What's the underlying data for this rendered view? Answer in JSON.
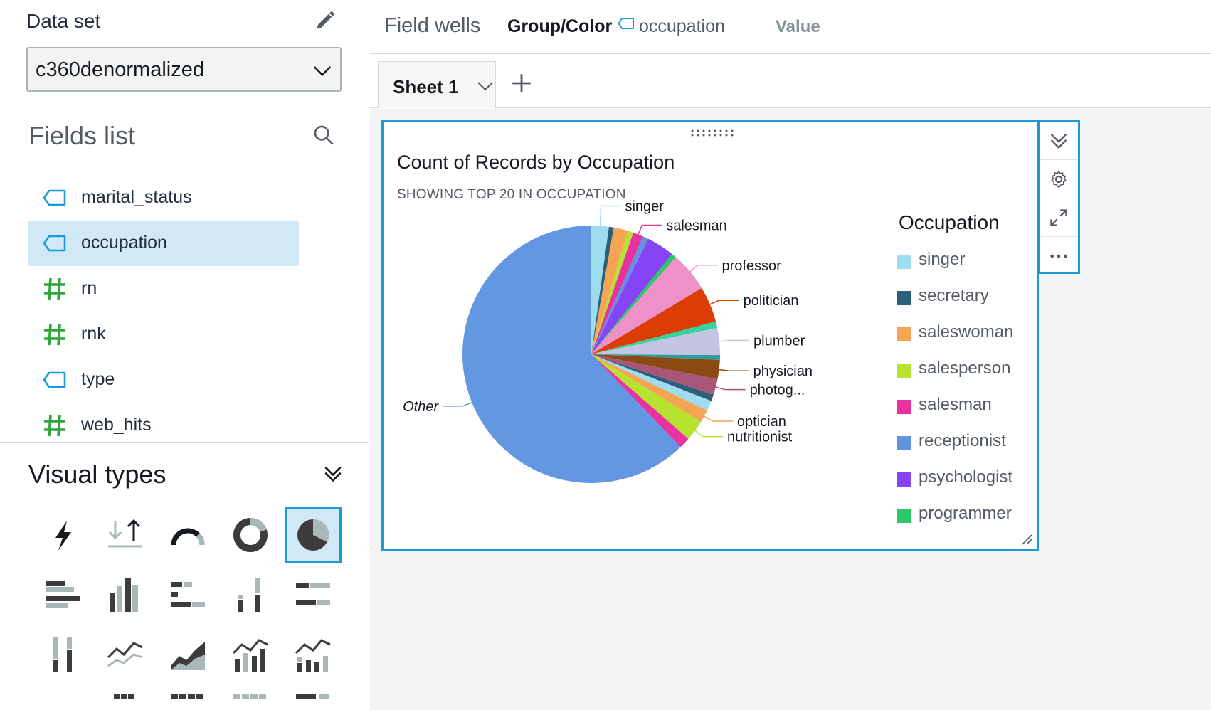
{
  "dataset": {
    "title": "Data set",
    "selected": "c360denormalized"
  },
  "fields_list": {
    "title": "Fields list",
    "items": [
      {
        "label": "marital_status",
        "kind": "dimension"
      },
      {
        "label": "occupation",
        "kind": "dimension",
        "selected": true
      },
      {
        "label": "rn",
        "kind": "measure"
      },
      {
        "label": "rnk",
        "kind": "measure"
      },
      {
        "label": "type",
        "kind": "dimension"
      },
      {
        "label": "web_hits",
        "kind": "measure"
      }
    ]
  },
  "visual_types": {
    "title": "Visual types"
  },
  "field_wells": {
    "title": "Field wells",
    "group_color_label": "Group/Color",
    "group_color_value": "occupation",
    "value_label": "Value"
  },
  "sheet": {
    "tab_label": "Sheet 1"
  },
  "visual": {
    "title": "Count of Records by Occupation",
    "subtitle": "SHOWING TOP 20 IN OCCUPATION",
    "legend_title": "Occupation"
  },
  "colors": {
    "accent": "#1a9bd7",
    "selected_bg": "#d1e9f6",
    "dimension_icon": "#1a9bd7",
    "measure_icon": "#2ea53a"
  },
  "chart_data": {
    "type": "pie",
    "title": "Count of Records by Occupation",
    "subtitle": "SHOWING TOP 20 IN OCCUPATION",
    "legend_title": "Occupation",
    "legend_placement": "right",
    "slices": [
      {
        "label": "singer",
        "value": 2.2,
        "color": "#9edcf0",
        "outer_label": true
      },
      {
        "label": "secretary",
        "value": 0.6,
        "color": "#2b5f7a",
        "outer_label": false
      },
      {
        "label": "saleswoman",
        "value": 1.8,
        "color": "#f5a454",
        "outer_label": false
      },
      {
        "label": "salesperson",
        "value": 0.7,
        "color": "#b5e330",
        "outer_label": false
      },
      {
        "label": "salesman",
        "value": 1.3,
        "color": "#e7329f",
        "outer_label": true
      },
      {
        "label": "receptionist",
        "value": 0.7,
        "color": "#6392e0",
        "outer_label": false
      },
      {
        "label": "psychologist",
        "value": 3.5,
        "color": "#8545f5",
        "outer_label": false
      },
      {
        "label": "programmer",
        "value": 0.6,
        "color": "#2cc96a",
        "outer_label": false
      },
      {
        "label": "professor",
        "value": 5.0,
        "color": "#ee91c9",
        "outer_label": true
      },
      {
        "label": "politician",
        "value": 4.5,
        "color": "#dc3c06",
        "outer_label": true
      },
      {
        "label": "",
        "value": 0.8,
        "color": "#35d49a",
        "outer_label": false
      },
      {
        "label": "plumber",
        "value": 3.4,
        "color": "#c3c5e3",
        "outer_label": true
      },
      {
        "label": "",
        "value": 0.6,
        "color": "#2e9c9c",
        "outer_label": false
      },
      {
        "label": "physician",
        "value": 2.4,
        "color": "#8a4a12",
        "outer_label": true
      },
      {
        "label": "photog...",
        "value": 2.0,
        "color": "#a8577a",
        "outer_label": true
      },
      {
        "label": "",
        "value": 0.8,
        "color": "#2b5f7a",
        "outer_label": false
      },
      {
        "label": "",
        "value": 1.3,
        "color": "#9edcf0",
        "outer_label": false
      },
      {
        "label": "optician",
        "value": 1.6,
        "color": "#f5a454",
        "outer_label": true
      },
      {
        "label": "nutritionist",
        "value": 2.6,
        "color": "#b5e330",
        "outer_label": true
      },
      {
        "label": "",
        "value": 1.4,
        "color": "#e7329f",
        "outer_label": false
      },
      {
        "label": "Other",
        "value": 62.2,
        "color": "#6497e1",
        "outer_label": true,
        "italic": true
      }
    ],
    "legend": [
      {
        "label": "singer",
        "color": "#9edcf0"
      },
      {
        "label": "secretary",
        "color": "#2b5f7a"
      },
      {
        "label": "saleswoman",
        "color": "#f5a454"
      },
      {
        "label": "salesperson",
        "color": "#b5e330"
      },
      {
        "label": "salesman",
        "color": "#e7329f"
      },
      {
        "label": "receptionist",
        "color": "#6392e0"
      },
      {
        "label": "psychologist",
        "color": "#8545f5"
      },
      {
        "label": "programmer",
        "color": "#2cc96a"
      }
    ]
  }
}
